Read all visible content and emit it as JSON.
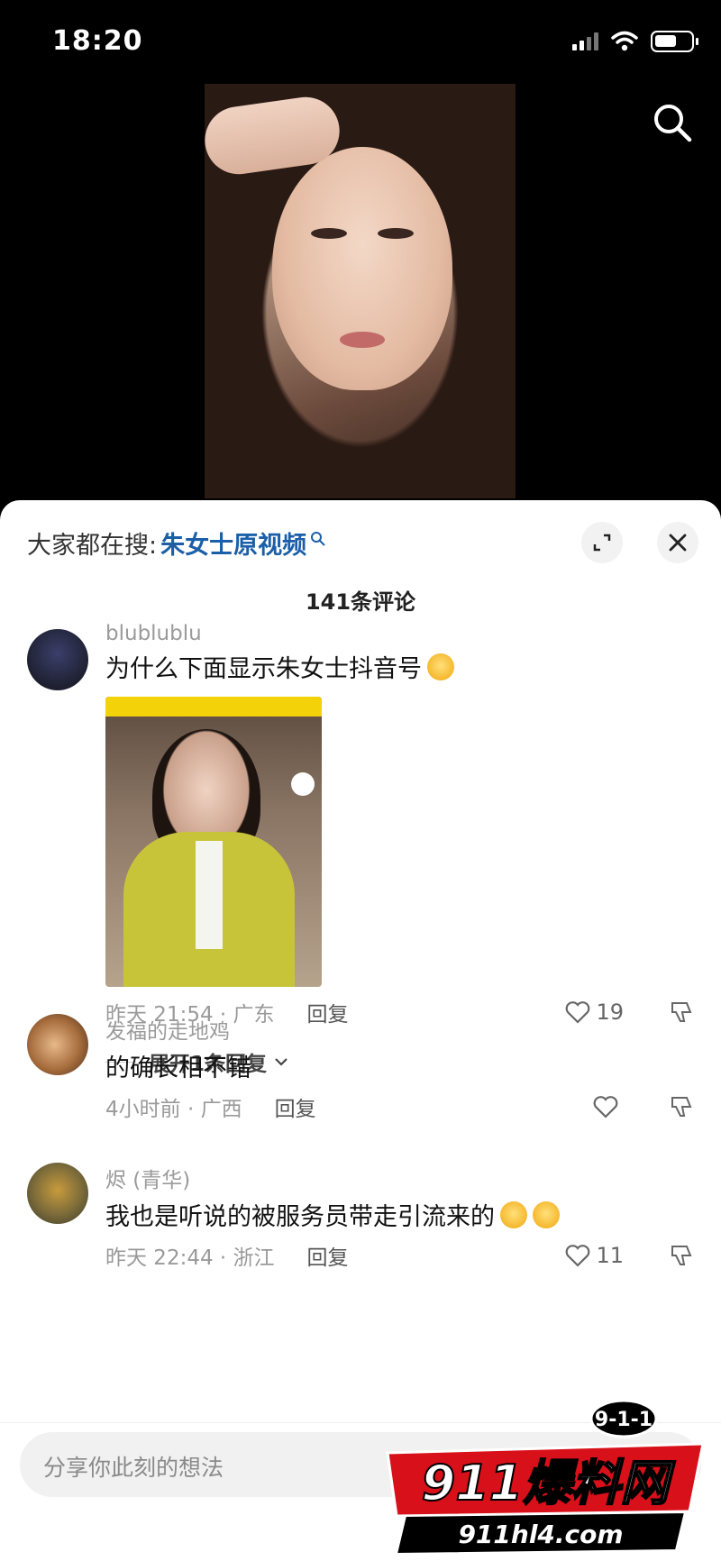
{
  "status_bar": {
    "time": "18:20",
    "battery_level": 0.6
  },
  "video": {
    "search_icon": "search-icon"
  },
  "sheet": {
    "hot_search_prefix": "大家都在搜:",
    "hot_search_term": "朱女士原视频",
    "comment_count": "141条评论"
  },
  "comments": [
    {
      "user": "blublublu",
      "text": "为什么下面显示朱女士抖音号",
      "meta": "昨天 21:54 · 广东",
      "reply": "回复",
      "likes": "19",
      "expand": "展开1条回复"
    },
    {
      "user": "发福的走地鸡",
      "text": "的确长相不错",
      "meta": "4小时前 · 广西",
      "reply": "回复",
      "likes": ""
    },
    {
      "user": "烬 (青华)",
      "text": "我也是听说的被服务员带走引流来的",
      "meta": "昨天 22:44 · 浙江",
      "reply": "回复",
      "likes": "11"
    }
  ],
  "input": {
    "placeholder": "分享你此刻的想法"
  },
  "watermark": {
    "badge": "9-1-1",
    "brand": "911爆料网",
    "url": "911hl4.com"
  },
  "colors": {
    "accent": "#1b5fa8",
    "brand_red": "#d8101a"
  }
}
